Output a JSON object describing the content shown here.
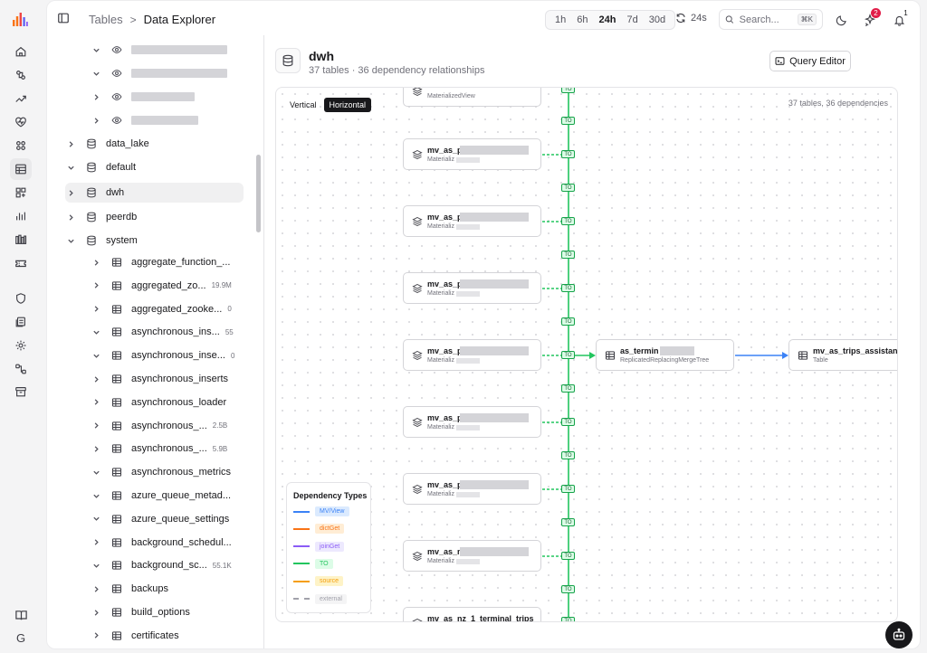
{
  "nav": {
    "items": [
      "home-icon",
      "plugs-icon",
      "trending-icon",
      "health-icon",
      "dashboard-icon",
      "tables-icon",
      "blocks-icon",
      "bar-chart-icon",
      "grid-chart-icon",
      "ticket-icon",
      "shield-icon",
      "logs-icon",
      "settings-icon",
      "flow-icon",
      "archive-icon"
    ],
    "docs_icon": "book-icon",
    "avatar_letter": "G"
  },
  "header": {
    "breadcrumb_parent": "Tables",
    "breadcrumb_separator": ">",
    "breadcrumb_current": "Data Explorer",
    "time_ranges": [
      "1h",
      "6h",
      "24h",
      "7d",
      "30d"
    ],
    "time_active": "24h",
    "refresh_label": "24s",
    "search_placeholder": "Search...",
    "search_shortcut": "⌘K",
    "notification_badge": "2",
    "bell_badge": "1"
  },
  "tree": {
    "redacted_rows": [
      {
        "expanded": true
      },
      {
        "expanded": true
      },
      {
        "expanded": false
      },
      {
        "expanded": false
      }
    ],
    "databases": [
      {
        "name": "data_lake",
        "expanded": false
      },
      {
        "name": "default",
        "expanded": true
      },
      {
        "name": "dwh",
        "expanded": false,
        "selected": true
      },
      {
        "name": "peerdb",
        "expanded": false
      },
      {
        "name": "system",
        "expanded": true
      }
    ],
    "system_tables": [
      {
        "name": "aggregate_function_...",
        "size": "",
        "expanded": false
      },
      {
        "name": "aggregated_zo...",
        "size": "19.9M",
        "expanded": false
      },
      {
        "name": "aggregated_zooke...",
        "size": "0",
        "expanded": false
      },
      {
        "name": "asynchronous_ins...",
        "size": "55",
        "expanded": true
      },
      {
        "name": "asynchronous_inse...",
        "size": "0",
        "expanded": true
      },
      {
        "name": "asynchronous_inserts",
        "size": "",
        "expanded": false
      },
      {
        "name": "asynchronous_loader",
        "size": "",
        "expanded": false
      },
      {
        "name": "asynchronous_...",
        "size": "2.5B",
        "expanded": false
      },
      {
        "name": "asynchronous_...",
        "size": "5.9B",
        "expanded": false
      },
      {
        "name": "asynchronous_metrics",
        "size": "",
        "expanded": true
      },
      {
        "name": "azure_queue_metad...",
        "size": "",
        "expanded": true
      },
      {
        "name": "azure_queue_settings",
        "size": "",
        "expanded": true
      },
      {
        "name": "background_schedul...",
        "size": "",
        "expanded": false
      },
      {
        "name": "background_sc...",
        "size": "55.1K",
        "expanded": true
      },
      {
        "name": "backups",
        "size": "",
        "expanded": false
      },
      {
        "name": "build_options",
        "size": "",
        "expanded": false
      },
      {
        "name": "certificates",
        "size": "",
        "expanded": false
      }
    ]
  },
  "content": {
    "title": "dwh",
    "subtitle": "37 tables · 36 dependency relationships",
    "query_editor_label": "Query Editor",
    "orientation_options": [
      "Vertical",
      "Horizontal"
    ],
    "orientation_active": "Horizontal",
    "graph_count": "37 tables, 36 dependencies",
    "to_label": "TO",
    "mv_nodes": [
      {
        "name": "",
        "type": "MaterializedView",
        "partial": true
      },
      {
        "name": "mv_as_p",
        "type": "Materializ"
      },
      {
        "name": "mv_as_p",
        "type": "Materializ"
      },
      {
        "name": "mv_as_p",
        "type": "Materializ"
      },
      {
        "name": "mv_as_p",
        "type": "Materializ"
      },
      {
        "name": "mv_as_p",
        "type": "Materializ"
      },
      {
        "name": "mv_as_p",
        "type": "Materializ"
      },
      {
        "name": "mv_as_n",
        "type": "Materializ"
      },
      {
        "name": "mv_as_nz_1_terminal_trips",
        "type": ""
      }
    ],
    "center_node": {
      "name": "as_termin",
      "type": "ReplicatedReplacingMergeTree"
    },
    "right_node": {
      "name": "mv_as_trips_assistant",
      "type": "Table"
    },
    "legend": {
      "title": "Dependency Types",
      "items": [
        {
          "label": "MV/View",
          "color": "#3b82f6",
          "bg": "#dbeafe",
          "style": "solid"
        },
        {
          "label": "dictGet",
          "color": "#f97316",
          "bg": "#ffedd5",
          "style": "solid"
        },
        {
          "label": "joinGet",
          "color": "#8b5cf6",
          "bg": "#ede9fe",
          "style": "solid"
        },
        {
          "label": "TO",
          "color": "#22c55e",
          "bg": "#dcfce7",
          "style": "solid"
        },
        {
          "label": "source",
          "color": "#f59e0b",
          "bg": "#fef3c7",
          "style": "solid"
        },
        {
          "label": "external",
          "color": "#a1a1aa",
          "bg": "#f4f4f5",
          "style": "dashed"
        }
      ]
    }
  },
  "colors": {
    "to_green": "#22c55e",
    "mv_blue": "#3b82f6",
    "badge_red": "#e11d48",
    "text_dark": "#18181b"
  }
}
